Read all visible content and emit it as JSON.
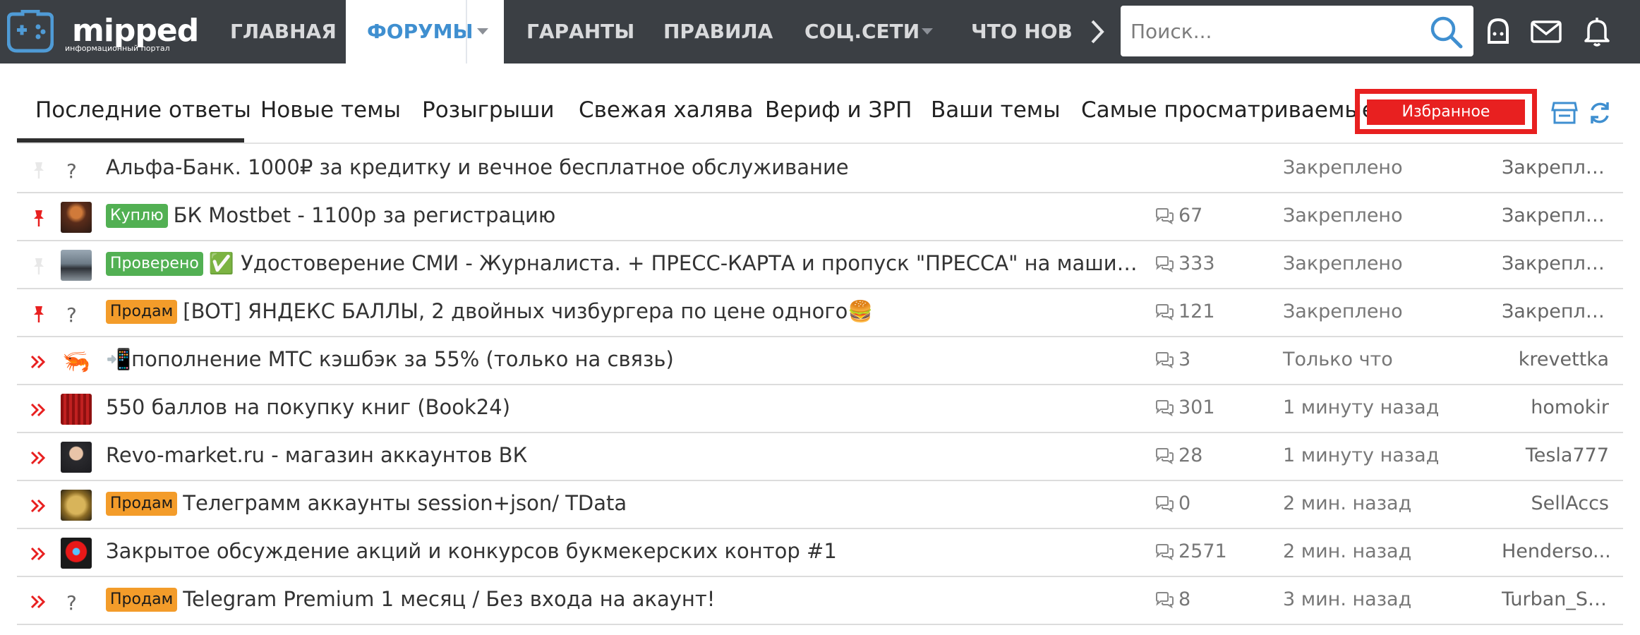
{
  "logo": {
    "name": "mipped",
    "tagline": "информационный портал"
  },
  "nav": {
    "items": [
      {
        "label": "ГЛАВНАЯ"
      },
      {
        "label": "ФОРУМЫ"
      },
      {
        "label": "ГАРАНТЫ"
      },
      {
        "label": "ПРАВИЛА"
      },
      {
        "label": "СОЦ.СЕТИ"
      },
      {
        "label": "ЧТО НОВ"
      }
    ],
    "active_index": 1
  },
  "search": {
    "placeholder": "Поиск..."
  },
  "tabs": {
    "items": [
      {
        "label": "Последние ответы"
      },
      {
        "label": "Новые темы"
      },
      {
        "label": "Розыгрыши"
      },
      {
        "label": "Свежая халява"
      },
      {
        "label": "Вериф и ЗРП"
      },
      {
        "label": "Ваши темы"
      },
      {
        "label": "Самые просматриваемые"
      }
    ],
    "favorite_label": "Избранное",
    "active_index": 0
  },
  "colors": {
    "topbar": "#3b3f44",
    "accent": "#3f8fd0",
    "highlight_red": "#e82020",
    "badge_green": "#52b053",
    "badge_orange": "#f39c2a"
  },
  "threads": [
    {
      "status_icon": "pin-icon-faded",
      "avatar": "question",
      "badge": "",
      "title": "Альфа-Банк. 1000₽ за кредитку и вечное бесплатное обслуживание",
      "replies": "",
      "time": "Закреплено",
      "author": "Закрепле..."
    },
    {
      "status_icon": "pin-icon",
      "avatar": "user-avatar",
      "badge": "Куплю",
      "title": "БК Mostbet - 1100р за регистрацию",
      "replies": "67",
      "time": "Закреплено",
      "author": "Закрепле..."
    },
    {
      "status_icon": "pin-icon-faded",
      "avatar": "user-avatar",
      "badge": "Проверено",
      "title": "✅ Удостоверение СМИ - Журналиста. + ПРЕСС-КАРТА и пропуск \"ПРЕССА\" на машину. ЛЕГАЛ...",
      "replies": "333",
      "time": "Закреплено",
      "author": "Закрепле..."
    },
    {
      "status_icon": "pin-icon",
      "avatar": "question",
      "badge": "Продам",
      "title": "[BOT] ЯНДЕКС БАЛЛЫ, 2 двойных чизбургера по цене одного🍔",
      "replies": "121",
      "time": "Закреплено",
      "author": "Закрепле..."
    },
    {
      "status_icon": "double-chevron-icon",
      "avatar": "shrimp",
      "badge": "",
      "title": "📲пополнение МТС кэшбэк за 55% (только на связь)",
      "replies": "3",
      "time": "Только что",
      "author": "krevettka"
    },
    {
      "status_icon": "double-chevron-icon",
      "avatar": "user-avatar",
      "badge": "",
      "title": "550 баллов на покупку книг (Book24)",
      "replies": "301",
      "time": "1 минуту назад",
      "author": "homokir"
    },
    {
      "status_icon": "double-chevron-icon",
      "avatar": "user-avatar",
      "badge": "",
      "title": "Revo-market.ru - магазин аккаунтов ВК",
      "replies": "28",
      "time": "1 минуту назад",
      "author": "Tesla777"
    },
    {
      "status_icon": "double-chevron-icon",
      "avatar": "user-avatar",
      "badge": "Продам",
      "title": "Телеграмм аккаунты session+json/ TData",
      "replies": "0",
      "time": "2 мин. назад",
      "author": "SellAccs"
    },
    {
      "status_icon": "double-chevron-icon",
      "avatar": "user-avatar",
      "badge": "",
      "title": "Закрытое обсуждение акций и конкурсов букмекерских контор #1",
      "replies": "2571",
      "time": "2 мин. назад",
      "author": "Henderso..."
    },
    {
      "status_icon": "double-chevron-icon",
      "avatar": "question",
      "badge": "Продам",
      "title": "Telegram Premium 1 месяц / Без входа на акаунт!",
      "replies": "8",
      "time": "3 мин. назад",
      "author": "Turban_Se..."
    }
  ]
}
